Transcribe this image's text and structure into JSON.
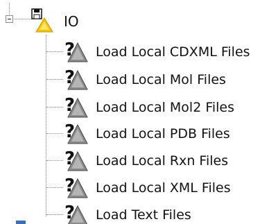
{
  "tree": {
    "root": {
      "label": "IO",
      "icon": "floppy-warning-icon",
      "expanded": true
    },
    "items": [
      {
        "label": "Load Local CDXML Files",
        "icon": "unknown-file-icon"
      },
      {
        "label": "Load Local Mol Files",
        "icon": "unknown-file-icon"
      },
      {
        "label": "Load Local Mol2 Files",
        "icon": "unknown-file-icon"
      },
      {
        "label": "Load Local PDB Files",
        "icon": "unknown-file-icon"
      },
      {
        "label": "Load Local Rxn Files",
        "icon": "unknown-file-icon"
      },
      {
        "label": "Load Local XML Files",
        "icon": "unknown-file-icon"
      },
      {
        "label": "Load Text Files",
        "icon": "unknown-file-icon"
      }
    ]
  },
  "colors": {
    "warning": "#f5c400",
    "icon_dark": "#111111",
    "icon_gray": "#8c8c8c",
    "text": "#111111"
  }
}
